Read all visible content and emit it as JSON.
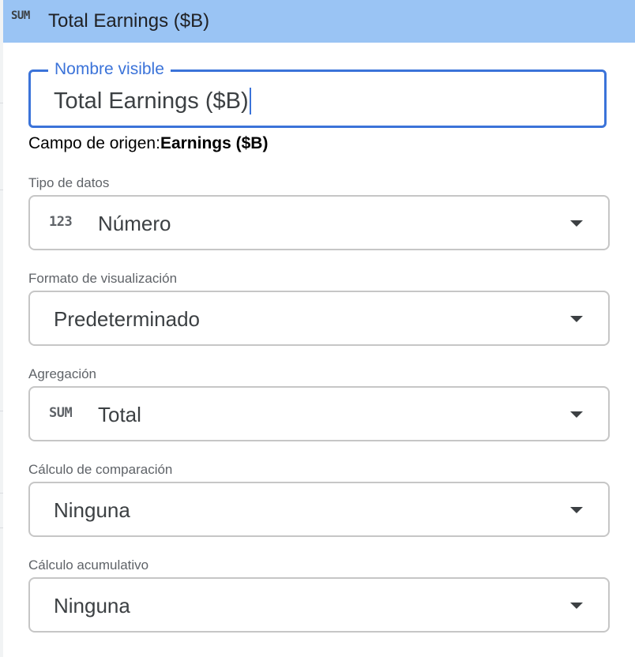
{
  "header": {
    "icon": "sum-icon",
    "icon_text": "SUM",
    "title": "Total Earnings ($B)"
  },
  "name_field": {
    "label": "Nombre visible",
    "value": "Total Earnings ($B)"
  },
  "source_field": {
    "label": "Campo de origen:",
    "value": "Earnings ($B)"
  },
  "fields": {
    "data_type": {
      "label": "Tipo de datos",
      "icon": "number-icon",
      "icon_text": "123",
      "value": "Número"
    },
    "display_format": {
      "label": "Formato de visualización",
      "value": "Predeterminado"
    },
    "aggregation": {
      "label": "Agregación",
      "icon": "sum-icon",
      "icon_text": "SUM",
      "value": "Total"
    },
    "comparison": {
      "label": "Cálculo de comparación",
      "value": "Ninguna"
    },
    "cumulative": {
      "label": "Cálculo acumulativo",
      "value": "Ninguna"
    }
  },
  "colors": {
    "header_bg": "#9ac4f4",
    "focus_accent": "#3b73d9",
    "border": "#c6c6c6"
  }
}
